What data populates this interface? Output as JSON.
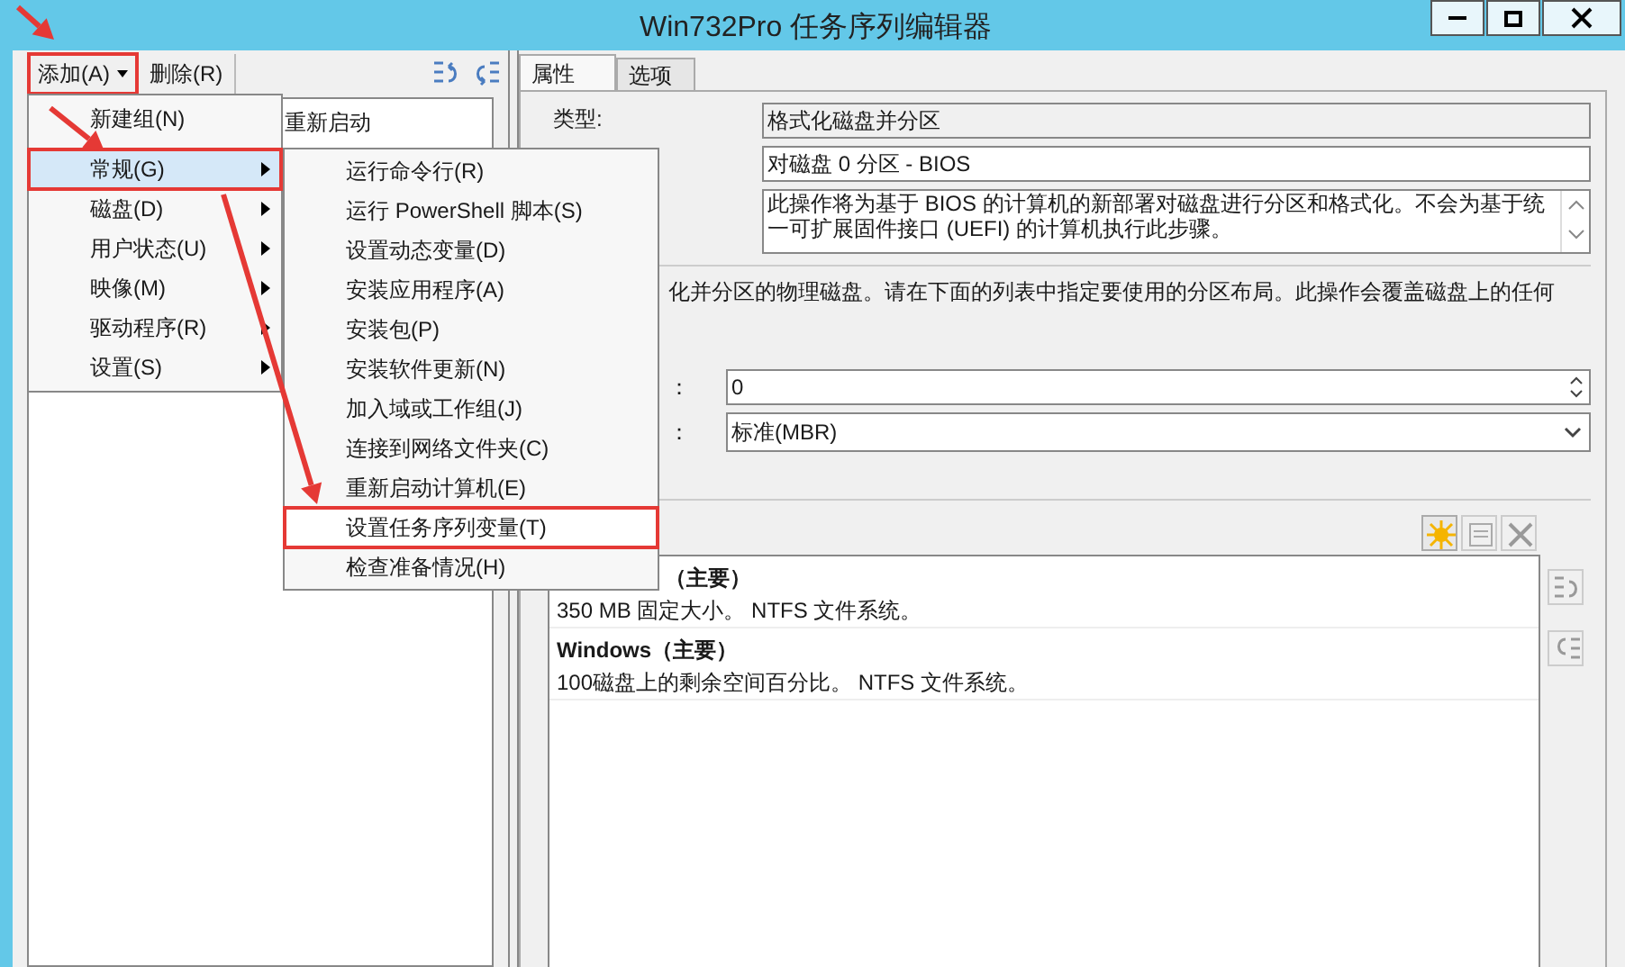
{
  "window": {
    "title": "Win732Pro 任务序列编辑器"
  },
  "left_toolbar": {
    "add_button": {
      "label": "添加(A)",
      "highlighted": true
    },
    "delete_button": {
      "label": "删除(R)"
    }
  },
  "tree": {
    "items": [
      {
        "label": "重新启动"
      }
    ]
  },
  "add_menu": {
    "items": [
      {
        "label": "新建组(N)",
        "has_submenu": false,
        "selected": false,
        "highlighted": false
      },
      {
        "label": "常规(G)",
        "has_submenu": true,
        "selected": true,
        "highlighted": true
      },
      {
        "label": "磁盘(D)",
        "has_submenu": true,
        "selected": false,
        "highlighted": false
      },
      {
        "label": "用户状态(U)",
        "has_submenu": true,
        "selected": false,
        "highlighted": false
      },
      {
        "label": "映像(M)",
        "has_submenu": true,
        "selected": false,
        "highlighted": false
      },
      {
        "label": "驱动程序(R)",
        "has_submenu": true,
        "selected": false,
        "highlighted": false
      },
      {
        "label": "设置(S)",
        "has_submenu": true,
        "selected": false,
        "highlighted": false
      }
    ]
  },
  "general_submenu": {
    "items": [
      {
        "label": "运行命令行(R)",
        "highlighted": false
      },
      {
        "label": "运行 PowerShell 脚本(S)",
        "highlighted": false
      },
      {
        "label": "设置动态变量(D)",
        "highlighted": false
      },
      {
        "label": "安装应用程序(A)",
        "highlighted": false
      },
      {
        "label": "安装包(P)",
        "highlighted": false
      },
      {
        "label": "安装软件更新(N)",
        "highlighted": false
      },
      {
        "label": "加入域或工作组(J)",
        "highlighted": false
      },
      {
        "label": "连接到网络文件夹(C)",
        "highlighted": false
      },
      {
        "label": "重新启动计算机(E)",
        "highlighted": false
      },
      {
        "label": "设置任务序列变量(T)",
        "highlighted": true
      },
      {
        "label": "检查准备情况(H)",
        "highlighted": false
      }
    ]
  },
  "tabs": [
    {
      "label": "属性",
      "selected": true
    },
    {
      "label": "选项",
      "selected": false
    }
  ],
  "properties": {
    "type_label": "类型:",
    "type_value": "格式化磁盘并分区",
    "name_value": "对磁盘 0 分区 - BIOS",
    "description_value": "此操作将为基于 BIOS 的计算机的新部署对磁盘进行分区和格式化。不会为基于统一可扩展固件接口 (UEFI) 的计算机执行此步骤。",
    "instructions": "化并分区的物理磁盘。请在下面的列表中指定要使用的分区布局。此操作会覆盖磁盘上的任何",
    "fields": [
      {
        "label": "：",
        "kind": "spin",
        "value": "0"
      },
      {
        "label": "：",
        "kind": "select",
        "value": "标准(MBR)"
      }
    ]
  },
  "partitions": [
    {
      "title": "（主要）",
      "detail": "350 MB 固定大小。 NTFS 文件系统。"
    },
    {
      "title": "Windows（主要）",
      "detail": "100磁盘上的剩余空间百分比。 NTFS 文件系统。"
    }
  ]
}
